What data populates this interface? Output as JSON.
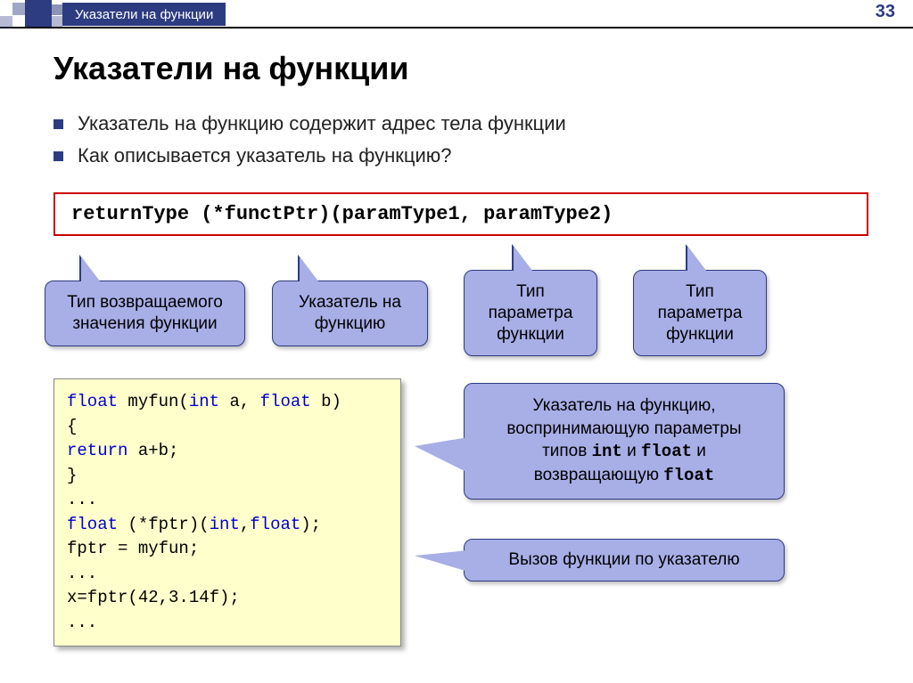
{
  "page_number": "33",
  "topbar_title": "Указатели на функции",
  "title": "Указатели на функции",
  "bullets": [
    "Указатель на функцию содержит адрес тела функции",
    "Как описывается указатель на функцию?"
  ],
  "syntax_line": "returnType  (*functPtr)(paramType1, paramType2)",
  "callouts": {
    "return_type": "Тип возвращаемого значения функции",
    "func_ptr": "Указатель на функцию",
    "param1": "Тип параметра функции",
    "param2": "Тип параметра функции"
  },
  "code_example": {
    "l1a": "float",
    "l1b": " myfun(",
    "l1c": "int",
    "l1d": " a, ",
    "l1e": "float",
    "l1f": " b)",
    "l2": "{",
    "l3a": "  ",
    "l3b": "return",
    "l3c": " a+b;",
    "l4": "}",
    "l5": "...",
    "l6a": "float",
    "l6b": " (*fptr)(",
    "l6c": "int",
    "l6d": ",",
    "l6e": "float",
    "l6f": ");",
    "l7": "fptr = myfun;",
    "l8": "...",
    "l9": "x=fptr(42,3.14f);",
    "l10": "..."
  },
  "side_callouts": {
    "desc_line1": "Указатель на функцию,",
    "desc_line2": "воспринимающую параметры",
    "desc_line3a": "типов ",
    "desc_mono1": "int",
    "desc_line3b": " и ",
    "desc_mono2": "float",
    "desc_line3c": " и",
    "desc_line4a": "возвращающую ",
    "desc_mono3": "float",
    "call_label": "Вызов функции по указателю"
  }
}
